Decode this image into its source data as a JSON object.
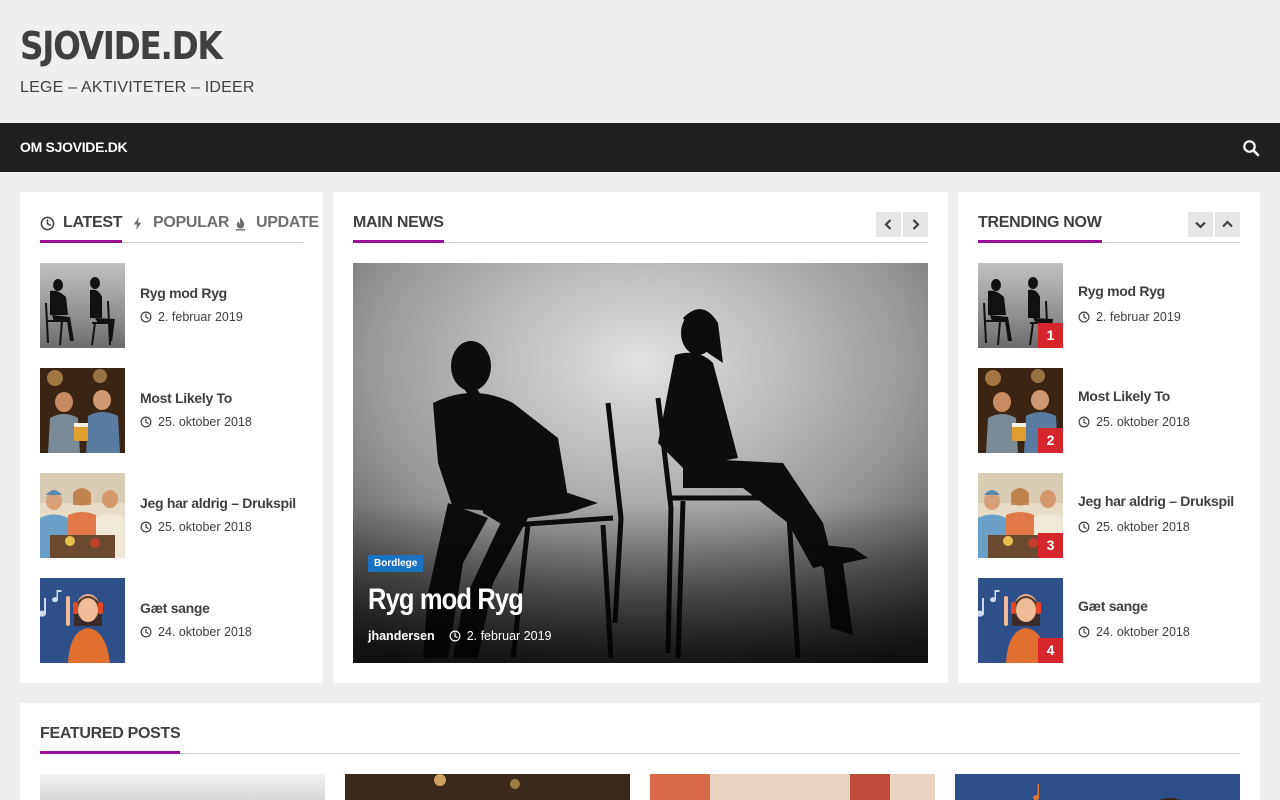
{
  "site": {
    "title": "SJOVIDE.DK",
    "tagline": "LEGE – AKTIVITETER – IDEER"
  },
  "nav": {
    "items": [
      {
        "label": "OM SJOVIDE.DK"
      }
    ],
    "search_icon": "search-icon"
  },
  "tabs": [
    {
      "label": "LATEST",
      "icon": "clock-icon",
      "active": true
    },
    {
      "label": "POPULAR",
      "icon": "bolt-icon",
      "active": false
    },
    {
      "label": "UPDATE",
      "icon": "fire-icon",
      "active": false
    }
  ],
  "latest": [
    {
      "title": "Ryg mod Ryg",
      "date": "2. februar 2019"
    },
    {
      "title": "Most Likely To",
      "date": "25. oktober 2018"
    },
    {
      "title": "Jeg har aldrig – Drukspil",
      "date": "25. oktober 2018"
    },
    {
      "title": "Gæt sange",
      "date": "24. oktober 2018"
    }
  ],
  "main_news": {
    "title": "MAIN NEWS",
    "hero": {
      "category": "Bordlege",
      "title": "Ryg mod Ryg",
      "author": "jhandersen",
      "date": "2. februar 2019"
    }
  },
  "trending": {
    "title": "TRENDING NOW",
    "items": [
      {
        "rank": "1",
        "title": "Ryg mod Ryg",
        "date": "2. februar 2019"
      },
      {
        "rank": "2",
        "title": "Most Likely To",
        "date": "25. oktober 2018"
      },
      {
        "rank": "3",
        "title": "Jeg har aldrig – Drukspil",
        "date": "25. oktober 2018"
      },
      {
        "rank": "4",
        "title": "Gæt sange",
        "date": "24. oktober 2018"
      }
    ]
  },
  "featured": {
    "title": "FEATURED POSTS"
  },
  "colors": {
    "accent": "#9b0f9b",
    "rank_badge": "#d7262b",
    "category_badge": "#1a73c2",
    "navbar": "#202020"
  }
}
